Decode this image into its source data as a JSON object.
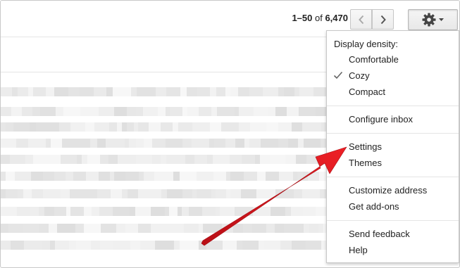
{
  "pager": {
    "range": "1–50",
    "of": "of",
    "total": "6,470"
  },
  "icons": {
    "prev": "chevron-left-icon",
    "next": "chevron-right-icon",
    "settings": "gear-icon",
    "dropdown": "caret-down-icon",
    "check": "checkmark-icon"
  },
  "menu": {
    "density_heading": "Display density:",
    "comfortable": "Comfortable",
    "cozy": "Cozy",
    "compact": "Compact",
    "configure_inbox": "Configure inbox",
    "settings": "Settings",
    "themes": "Themes",
    "customize_address": "Customize address",
    "get_addons": "Get add-ons",
    "send_feedback": "Send feedback",
    "help": "Help",
    "selected_density": "Cozy"
  },
  "colors": {
    "annotation_arrow": "#d9141c",
    "blurred_row": "#e9e9e9"
  }
}
